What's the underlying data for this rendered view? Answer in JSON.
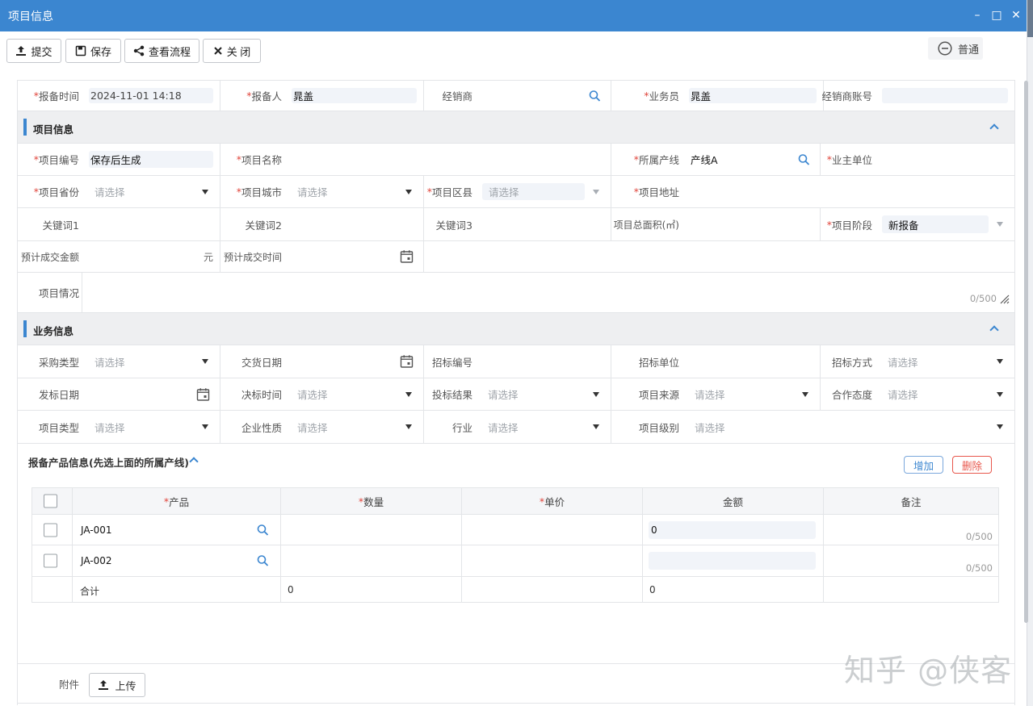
{
  "window": {
    "title": "项目信息",
    "min": "–",
    "max": "□",
    "close": "✕"
  },
  "toolbar": {
    "submit": "提交",
    "save": "保存",
    "flow": "查看流程",
    "close": "关 闭",
    "mode": "普通"
  },
  "top_row": {
    "report_time_label": "报备时间",
    "report_time_value": "2024-11-01 14:18",
    "reporter_label": "报备人",
    "reporter_value": "晁盖",
    "dealer_label": "经销商",
    "salesman_label": "业务员",
    "salesman_value": "晁盖",
    "dealer_account_label": "经销商账号"
  },
  "project_section": {
    "title": "项目信息",
    "project_no_label": "项目编号",
    "project_no_value": "保存后生成",
    "project_name_label": "项目名称",
    "product_line_label": "所属产线",
    "product_line_value": "产线A",
    "owner_unit_label": "业主单位",
    "province_label": "项目省份",
    "province_value": "请选择",
    "city_label": "项目城市",
    "city_value": "请选择",
    "district_label": "项目区县",
    "district_value": "请选择",
    "address_label": "项目地址",
    "keyword1_label": "关键词1",
    "keyword2_label": "关键词2",
    "keyword3_label": "关键词3",
    "area_label": "项目总面积(㎡)",
    "stage_label": "项目阶段",
    "stage_value": "新报备",
    "amount_label": "预计成交金额",
    "amount_unit": "元",
    "deal_time_label": "预计成交时间",
    "situation_label": "项目情况",
    "situation_counter": "0/500"
  },
  "business_section": {
    "title": "业务信息",
    "purchase_type_label": "采购类型",
    "purchase_type_value": "请选择",
    "delivery_date_label": "交货日期",
    "bid_no_label": "招标编号",
    "bid_unit_label": "招标单位",
    "bid_method_label": "招标方式",
    "bid_method_value": "请选择",
    "bid_issue_date_label": "发标日期",
    "bid_decide_label": "决标时间",
    "bid_decide_value": "请选择",
    "bid_result_label": "投标结果",
    "bid_result_value": "请选择",
    "source_label": "项目来源",
    "source_value": "请选择",
    "attitude_label": "合作态度",
    "attitude_value": "请选择",
    "project_type_label": "项目类型",
    "project_type_value": "请选择",
    "enterprise_label": "企业性质",
    "enterprise_value": "请选择",
    "industry_label": "行业",
    "industry_value": "请选择",
    "level_label": "项目级别",
    "level_value": "请选择"
  },
  "products": {
    "title": "报备产品信息(先选上面的所属产线)",
    "add": "增加",
    "delete": "删除",
    "headers": {
      "product": "产品",
      "qty": "数量",
      "price": "单价",
      "amount": "金额",
      "remark": "备注"
    },
    "rows": [
      {
        "product": "JA-001",
        "amount": "0",
        "counter": "0/500"
      },
      {
        "product": "JA-002",
        "amount": "",
        "counter": "0/500"
      }
    ],
    "total_label": "合计",
    "total_qty": "0",
    "total_amount": "0"
  },
  "attachment": {
    "label": "附件",
    "upload": "上传"
  },
  "watermark": "知乎 @侠客",
  "colors": {
    "header_blue": "#3b86d0",
    "required_red": "#e0443b",
    "delete_red": "#e8564b"
  }
}
